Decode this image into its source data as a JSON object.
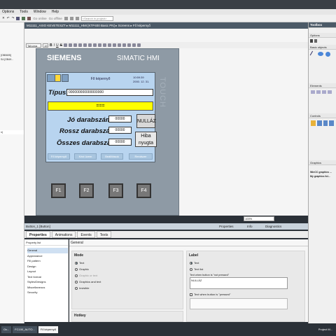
{
  "menu": [
    "Options",
    "Tools",
    "Window",
    "Help"
  ],
  "toolbar": {
    "go_online": "Go online",
    "go_offline": "Go offline",
    "search_placeholder": "<Search in project>"
  },
  "breadcrumb": "M11111_AXIO KEVETESZT ▸ M11111_HMI [KTP400 Basic PN] ▸ Screens ▸ Fő képernyő",
  "left_tree": [
    "[OB0605]",
    "S4 [OB49...",
    "",
    "",
    "",
    "",
    "",
    "",
    "",
    "",
    "",
    "",
    "",
    "",
    "",
    "",
    "",
    "",
    "",
    "",
    "",
    "",
    "",
    "",
    "",
    "n)"
  ],
  "editor": {
    "font": "Tahoma",
    "size": "19",
    "zoom": "100%"
  },
  "hmi": {
    "brand": "SIEMENS",
    "product": "SIMATIC HMI",
    "side_label": "TOUCH",
    "screen_title": "Fő képernyő",
    "time": "10:59:39",
    "date": "2000. 12. 31.",
    "tipus_label": "Típus:",
    "tipus_value": "000000000000000000",
    "status_text": "===",
    "jo_label": "Jó darabszám:",
    "rossz_label": "Rossz darabszám:",
    "osszes_label": "Összes darabszám:",
    "jo_value": "00000",
    "rossz_value": "00000",
    "osszes_value": "00000",
    "nullaz": "NULLÁZ",
    "hiba_line1": "Hiba",
    "hiba_line2": "nyugta",
    "nav": [
      "Fő képernyő",
      "Kézi üzem",
      "Beállítások",
      "Rendszer"
    ],
    "fkeys": [
      "F1",
      "F2",
      "F3",
      "F4"
    ]
  },
  "toolbox": {
    "title": "Toolbox",
    "options": "Options",
    "basic_objects": "Basic objects",
    "elements": "Elements",
    "controls": "Controls",
    "graphics": "Graphics",
    "graphics_items": [
      "WinCC graphics ...",
      "My graphics fol..."
    ]
  },
  "inspector": {
    "title": "Button_1 [Button]",
    "right_tabs": [
      "Properties",
      "Info",
      "Diagnostics"
    ],
    "tabs": [
      "Properties",
      "Animations",
      "Events",
      "Texts"
    ],
    "property_list": "Property list",
    "nav_items": [
      "General",
      "Appearance",
      "Fill pattern",
      "Design",
      "Layout",
      "Text format",
      "Styles/Designs",
      "Miscellaneous",
      "Security"
    ],
    "section": "General",
    "mode_title": "Mode",
    "mode_options": [
      "Text",
      "Graphic",
      "Graphic or text",
      "Graphics and text",
      "Invisible"
    ],
    "hotkey_title": "Hotkey",
    "label_title": "Label",
    "label_options": [
      "Text",
      "Text list"
    ],
    "text_not_pressed_label": "Text when button is \"not pressed\"",
    "text_not_pressed_value": "NULLÁZ",
    "text_pressed_label": "Text when button is \"pressed\""
  },
  "taskbar": [
    "Ov...",
    "FC100_AUTO...",
    "Fő képernyő"
  ],
  "taskbar_right": "Project M..."
}
